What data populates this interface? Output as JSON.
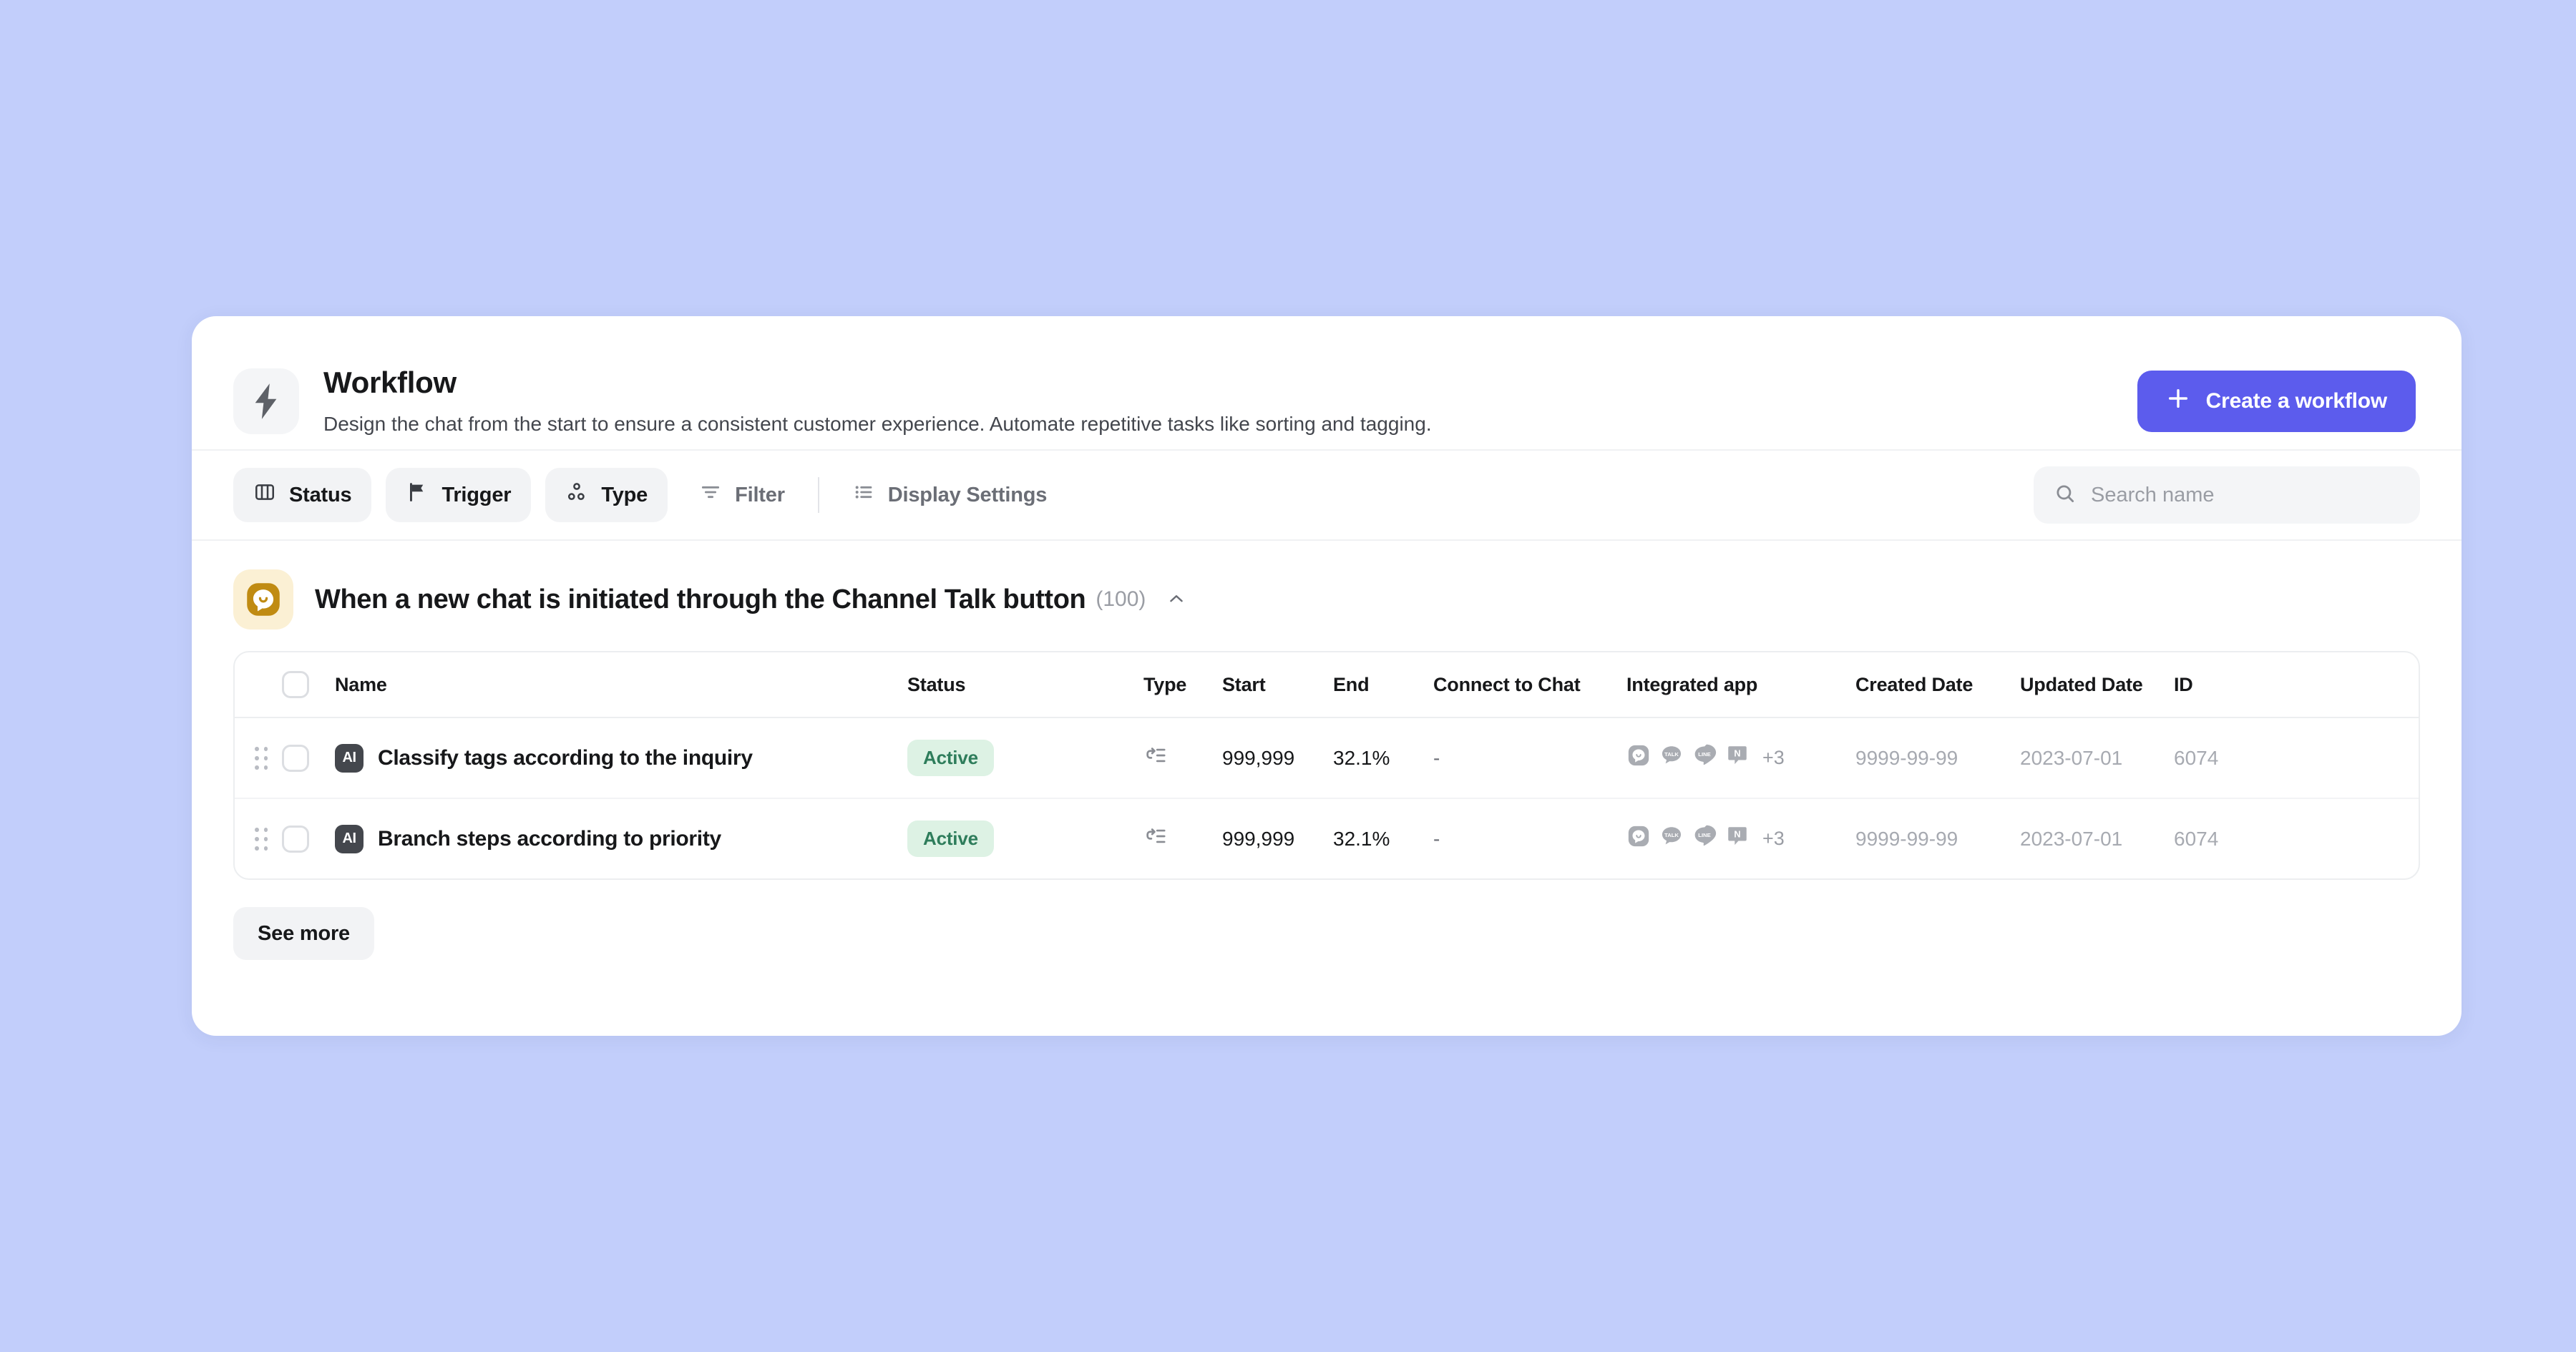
{
  "theme": {
    "page_background": "#c2cefb",
    "card_background": "#ffffff",
    "accent": "#5c5ced",
    "status_active_bg": "#ddf2e4",
    "status_active_fg": "#2e7d5b",
    "group_logo_bg": "#fbf0d4",
    "group_logo_fg": "#c08b12"
  },
  "header": {
    "icon": "lightning-bolt-icon",
    "title": "Workflow",
    "description": "Design the chat from the start to ensure a consistent customer experience. Automate repetitive tasks like sorting and tagging.",
    "create_button": {
      "label": "Create a workflow",
      "icon": "plus-icon"
    }
  },
  "toolbar": {
    "chips": [
      {
        "label": "Status",
        "icon": "columns-icon"
      },
      {
        "label": "Trigger",
        "icon": "flag-icon"
      },
      {
        "label": "Type",
        "icon": "nodes-icon"
      }
    ],
    "filter": {
      "label": "Filter",
      "icon": "filter-icon"
    },
    "display_settings": {
      "label": "Display Settings",
      "icon": "list-settings-icon"
    },
    "search": {
      "icon": "search-icon",
      "value": "",
      "placeholder": "Search name"
    }
  },
  "group": {
    "logo": "channel-talk-logo",
    "title": "When a new chat is initiated through the Channel Talk button",
    "count": "(100)",
    "collapse_icon": "chevron-up-icon",
    "expanded": true
  },
  "table": {
    "columns": [
      "Name",
      "Status",
      "Type",
      "Start",
      "End",
      "Connect to Chat",
      "Integrated app",
      "Created Date",
      "Updated Date",
      "ID"
    ],
    "rows": [
      {
        "drag_handle": "drag-handle-icon",
        "selected": false,
        "badge": "AI",
        "name": "Classify tags according to the inquiry",
        "status": "Active",
        "type_icon": "branch-to-list-icon",
        "start": "999,999",
        "end": "32.1%",
        "connect_to_chat": "-",
        "integrated_apps": [
          "channel-talk",
          "kakaotalk",
          "line",
          "naver"
        ],
        "integrated_apps_more": "+3",
        "created_date": "9999-99-99",
        "updated_date": "2023-07-01",
        "id": "6074"
      },
      {
        "drag_handle": "drag-handle-icon",
        "selected": false,
        "badge": "AI",
        "name": "Branch steps according to priority",
        "status": "Active",
        "type_icon": "branch-to-list-icon",
        "start": "999,999",
        "end": "32.1%",
        "connect_to_chat": "-",
        "integrated_apps": [
          "channel-talk",
          "kakaotalk",
          "line",
          "naver"
        ],
        "integrated_apps_more": "+3",
        "created_date": "9999-99-99",
        "updated_date": "2023-07-01",
        "id": "6074"
      }
    ]
  },
  "footer": {
    "see_more_label": "See more"
  }
}
